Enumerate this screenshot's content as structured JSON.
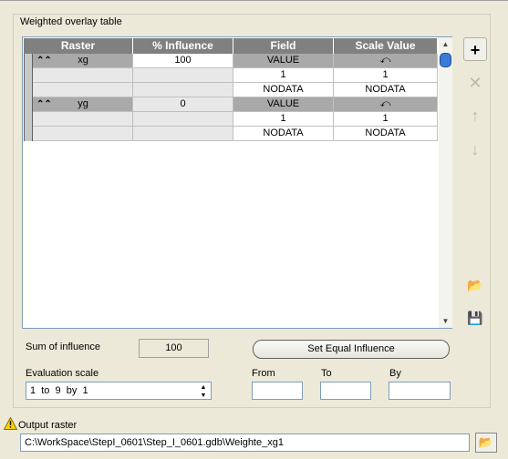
{
  "group_title": "Weighted overlay table",
  "table": {
    "headers": [
      "Raster",
      "% Influence",
      "Field",
      "Scale Value"
    ],
    "rasters": [
      {
        "name": "xg",
        "influence": "100",
        "field": "VALUE",
        "scale_header": "⤺",
        "rows": [
          {
            "field": "1",
            "scale": "1"
          },
          {
            "field": "NODATA",
            "scale": "NODATA"
          }
        ]
      },
      {
        "name": "yg",
        "influence": "0",
        "field": "VALUE",
        "scale_header": "⤺",
        "rows": [
          {
            "field": "1",
            "scale": "1"
          },
          {
            "field": "NODATA",
            "scale": "NODATA"
          }
        ]
      }
    ]
  },
  "side_buttons": {
    "add": "+",
    "remove": "✕",
    "up": "↑",
    "down": "↓",
    "open": "📂",
    "save": "💾"
  },
  "sum_label": "Sum of influence",
  "sum_value": "100",
  "equal_button": "Set Equal Influence",
  "eval_label": "Evaluation scale",
  "eval_value": "1  to  9  by  1",
  "from_label": "From",
  "to_label": "To",
  "by_label": "By",
  "from_value": "",
  "to_value": "",
  "by_value": "",
  "output_label": "Output raster",
  "output_value": "C:\\WorkSpace\\StepI_0601\\Step_I_0601.gdb\\Weighte_xg1",
  "browse_icon": "📂"
}
